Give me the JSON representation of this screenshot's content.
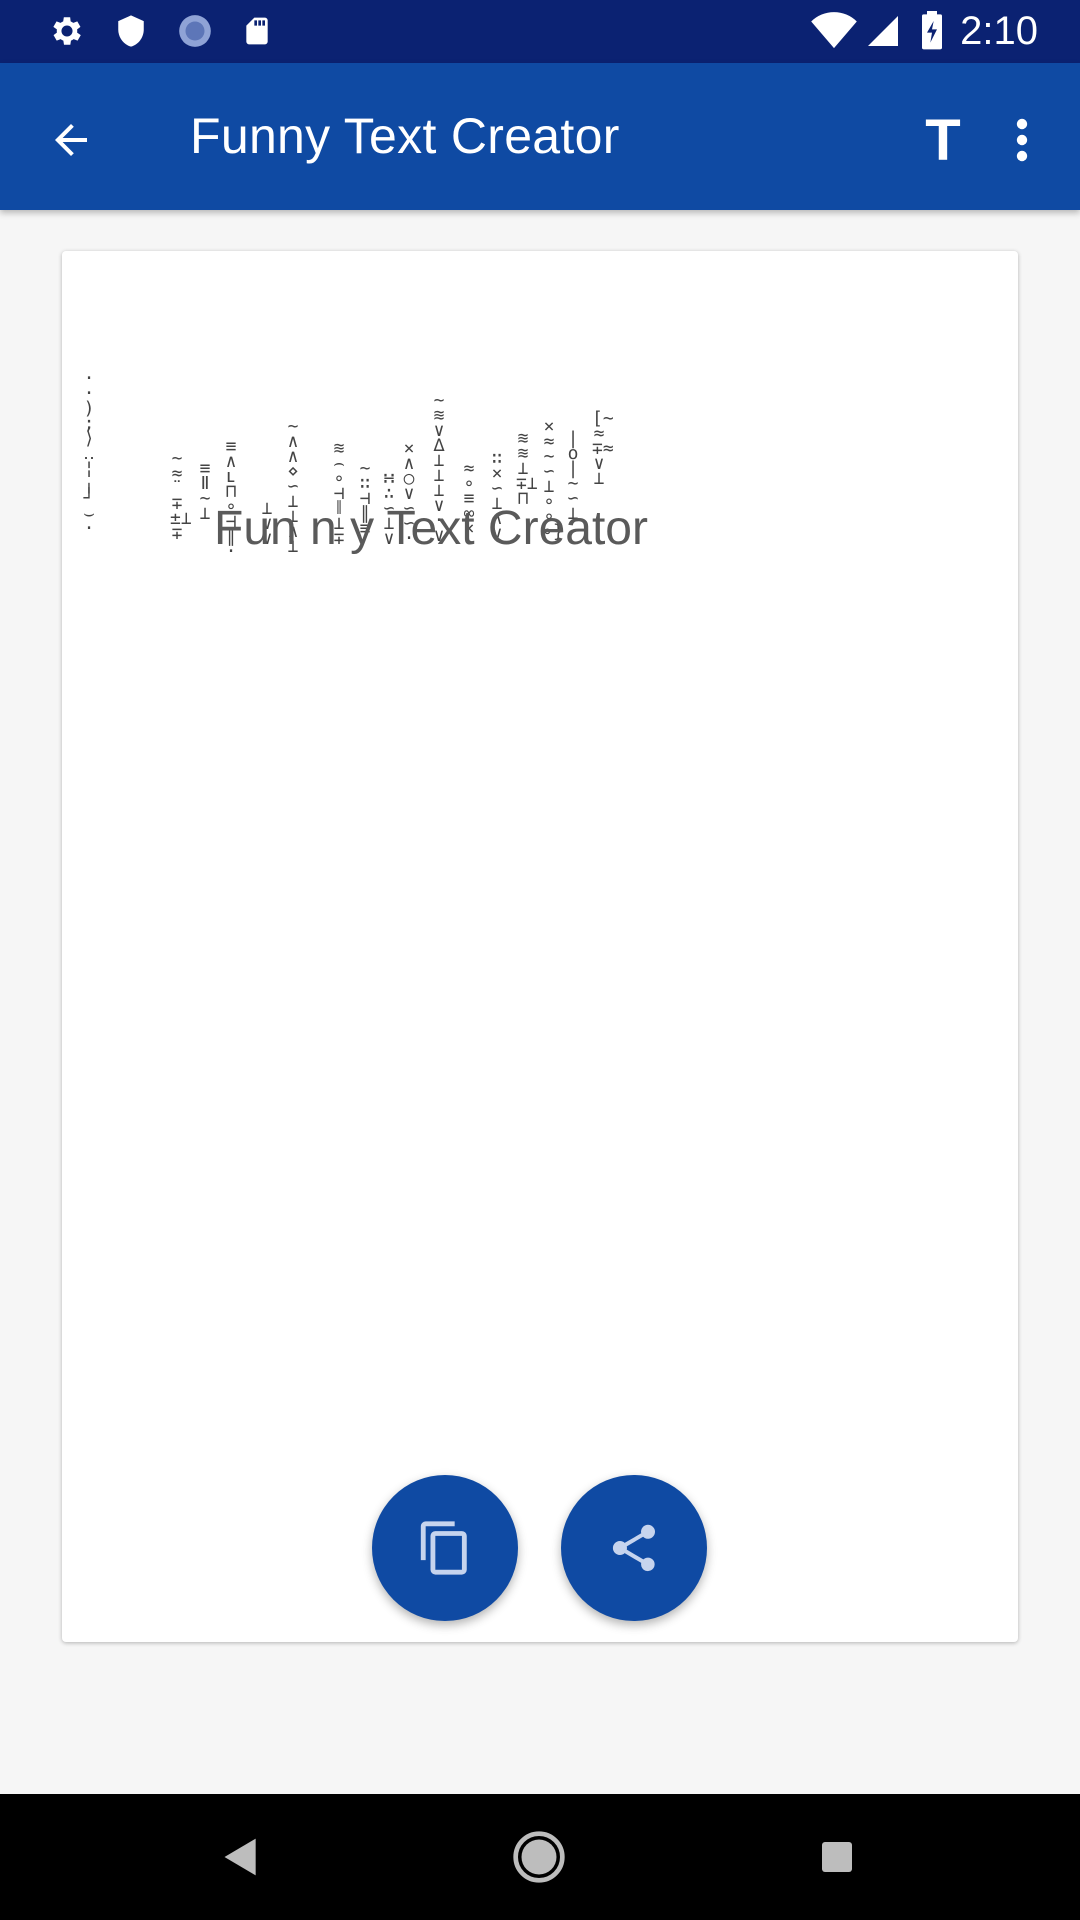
{
  "status_bar": {
    "time": "2:10",
    "left_icons": [
      "settings-icon",
      "shield-icon",
      "sync-icon",
      "sd-card-icon"
    ],
    "right_icons": [
      "wifi-icon",
      "signal-icon",
      "battery-charging-icon"
    ]
  },
  "app_bar": {
    "title": "Funny Text Creator",
    "actions": [
      "back-arrow-icon",
      "text-format-icon",
      "more-vert-icon"
    ],
    "font_button_label": "T"
  },
  "content": {
    "result_text": "Fun n y Text Creator"
  },
  "fabs": [
    {
      "name": "copy-button",
      "icon": "copy-icon"
    },
    {
      "name": "share-button",
      "icon": "share-icon"
    }
  ],
  "nav_bar": {
    "buttons": [
      "nav-back-icon",
      "nav-home-icon",
      "nav-recents-icon"
    ]
  },
  "colors": {
    "status_bar": "#0b2272",
    "app_bar": "#0f4aa3",
    "fab": "#0f4aa3",
    "background": "#f6f6f6"
  }
}
